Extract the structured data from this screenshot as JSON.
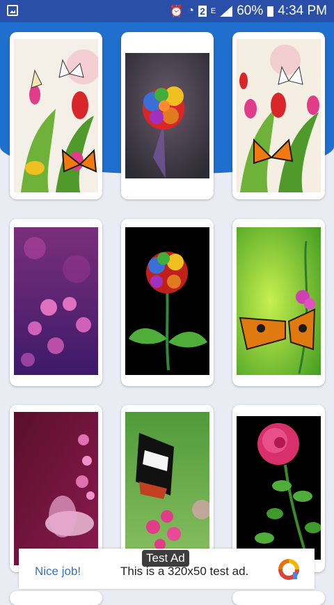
{
  "status_bar": {
    "battery": "60%",
    "time": "4:34 PM",
    "sim": "2",
    "network": "E"
  },
  "wallpapers": [
    {
      "subject": "tulips with butterflies"
    },
    {
      "subject": "rainbow rose"
    },
    {
      "subject": "tulips with butterflies"
    },
    {
      "subject": "purple flowers"
    },
    {
      "subject": "rainbow rose on black"
    },
    {
      "subject": "orange butterfly on green"
    },
    {
      "subject": "magenta fractal flower"
    },
    {
      "subject": "black and white butterfly on pink flowers"
    },
    {
      "subject": "pink rose on black"
    }
  ],
  "ad": {
    "label": "Test Ad",
    "title": "Nice job!",
    "text": "This is a 320x50 test ad."
  }
}
